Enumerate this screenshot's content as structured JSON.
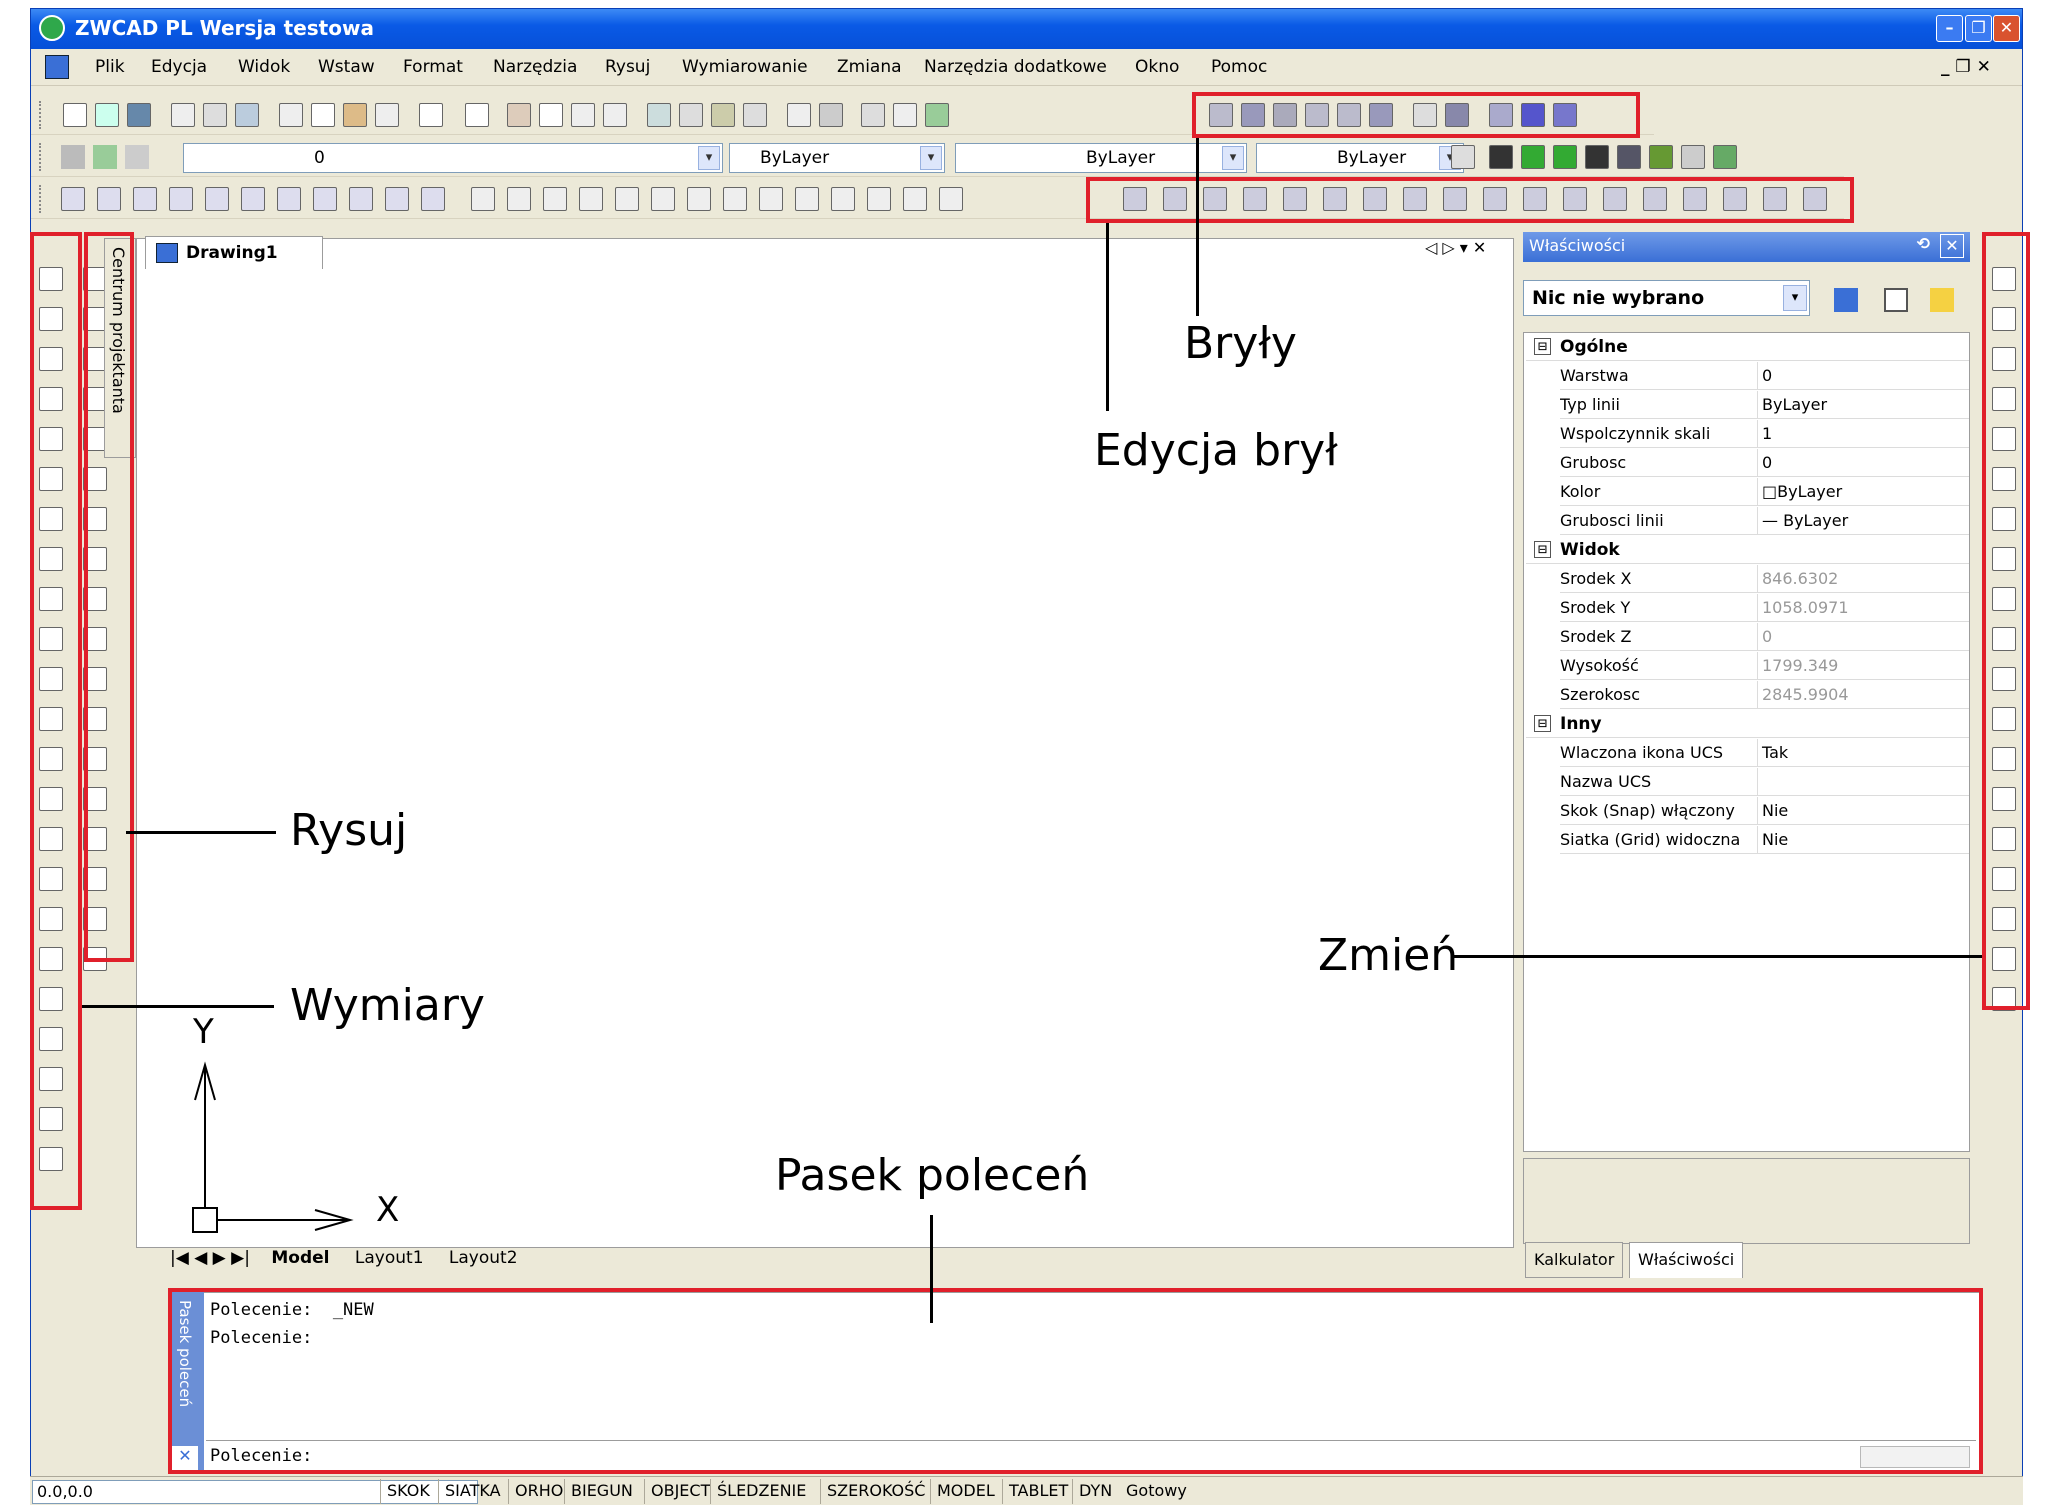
{
  "window": {
    "title": "ZWCAD PL Wersja testowa",
    "min": "–",
    "max": "❐",
    "close": "✕"
  },
  "menu": [
    "Plik",
    "Edycja",
    "Widok",
    "Wstaw",
    "Format",
    "Narzędzia",
    "Rysuj",
    "Wymiarowanie",
    "Zmiana",
    "Narzędzia dodatkowe",
    "Okno",
    "Pomoc"
  ],
  "layer_combo": "0",
  "color_combo": "ByLayer",
  "linetype_combo": "ByLayer",
  "lineweight_combo": "ByLayer",
  "doc_tab": "Drawing1",
  "tab_controls": "◁ ▷ ▾ ✕",
  "design_center_tab": "Centrum projektanta",
  "properties": {
    "title": "Właściwości",
    "selection": "Nic nie wybrano",
    "categories": [
      {
        "name": "Ogólne",
        "toggle": "⊟",
        "rows": [
          {
            "k": "Warstwa",
            "v": "0",
            "ro": false
          },
          {
            "k": "Typ linii",
            "v": "ByLayer",
            "ro": false
          },
          {
            "k": "Wspolczynnik skali",
            "v": "1",
            "ro": false
          },
          {
            "k": "Grubosc",
            "v": "0",
            "ro": false
          },
          {
            "k": "Kolor",
            "v": "□ByLayer",
            "ro": false
          },
          {
            "k": "Grubosci linii",
            "v": "— ByLayer",
            "ro": false
          }
        ]
      },
      {
        "name": "Widok",
        "toggle": "⊟",
        "rows": [
          {
            "k": "Srodek X",
            "v": "846.6302",
            "ro": true
          },
          {
            "k": "Srodek Y",
            "v": "1058.0971",
            "ro": true
          },
          {
            "k": "Srodek Z",
            "v": "0",
            "ro": true
          },
          {
            "k": "Wysokość",
            "v": "1799.349",
            "ro": true
          },
          {
            "k": "Szerokosc",
            "v": "2845.9904",
            "ro": true
          }
        ]
      },
      {
        "name": "Inny",
        "toggle": "⊟",
        "rows": [
          {
            "k": "Wlaczona ikona UCS",
            "v": "Tak",
            "ro": false
          },
          {
            "k": "Nazwa UCS",
            "v": "",
            "ro": false
          },
          {
            "k": "Skok (Snap) włączony",
            "v": "Nie",
            "ro": false
          },
          {
            "k": "Siatka (Grid) widoczna",
            "v": "Nie",
            "ro": false
          }
        ]
      }
    ],
    "bottom_tabs": [
      "Kalkulator",
      "Właściwości"
    ]
  },
  "layout_tabs": {
    "nav": "|◀ ◀ ▶ ▶|",
    "model": "Model",
    "l1": "Layout1",
    "l2": "Layout2"
  },
  "command": {
    "side": "Pasek poleceń",
    "lines": [
      "Polecenie:  _NEW",
      "Polecenie:"
    ],
    "prompt": "Polecenie:"
  },
  "ucs": {
    "y": "Y",
    "x": "X"
  },
  "status": {
    "coord": "0.0,0.0",
    "buttons": [
      "SKOK",
      "SIATKA",
      "ORHO",
      "BIEGUN",
      "OBJECT",
      "ŚLEDZENIE",
      "SZEROKOŚĆ",
      "MODEL",
      "TABLET",
      "DYN"
    ],
    "state": "Gotowy"
  },
  "annotations": {
    "bryly": "Bryły",
    "edycja": "Edycja brył",
    "rysuj": "Rysuj",
    "wymiary": "Wymiary",
    "zmien": "Zmień",
    "pasek": "Pasek poleceń"
  },
  "colors": {
    "title_bar": "#0a5ae6",
    "highlight": "#e0202b",
    "panel": "#ece9d8",
    "command_side": "#6b8fd6"
  }
}
